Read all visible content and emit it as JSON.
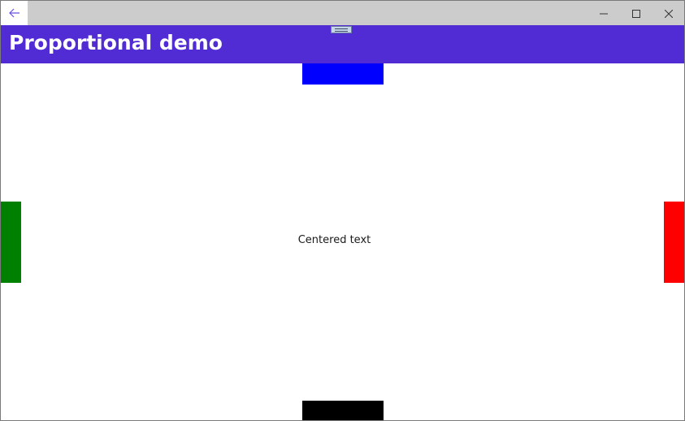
{
  "window": {
    "back_icon": "arrow-left-icon",
    "caption_icons": [
      "minimize-icon",
      "maximize-icon",
      "close-icon"
    ],
    "titlebar_color": "#cccccc",
    "accent_color": "#6b4fe0"
  },
  "appbar": {
    "title": "Proportional demo",
    "background": "#512bd4"
  },
  "content": {
    "center_text": "Centered text",
    "boxes": [
      {
        "name": "top",
        "color": "#0000ff"
      },
      {
        "name": "left",
        "color": "#008000"
      },
      {
        "name": "right",
        "color": "#ff0000"
      },
      {
        "name": "bottom",
        "color": "#000000"
      }
    ]
  }
}
